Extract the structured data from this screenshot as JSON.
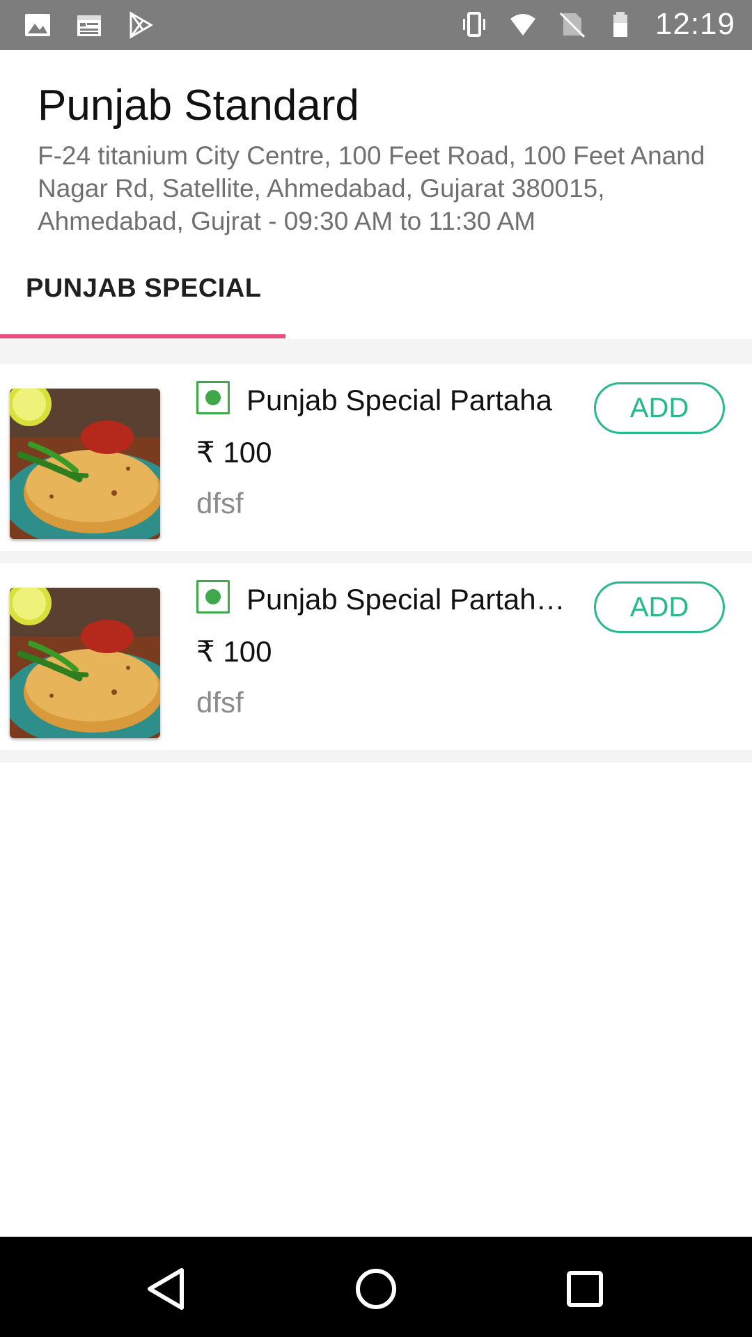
{
  "status_bar": {
    "time": "12:19",
    "left_icons": [
      "image-icon",
      "calendar-icon",
      "play-store-icon"
    ],
    "right_icons": [
      "vibrate-icon",
      "wifi-icon",
      "no-sim-icon",
      "battery-icon"
    ]
  },
  "restaurant": {
    "name": "Punjab Standard",
    "address": "F-24 titanium City Centre, 100 Feet Road, 100 Feet Anand Nagar Rd, Satellite, Ahmedabad, Gujarat 380015, Ahmedabad, Gujrat - 09:30 AM to 11:30 AM"
  },
  "tabs": [
    {
      "label": "PUNJAB SPECIAL",
      "active": true
    }
  ],
  "items": [
    {
      "name": "Punjab Special Partaha",
      "price": "₹ 100",
      "description": "dfsf",
      "add_label": "ADD",
      "veg": true
    },
    {
      "name": "Punjab Special Partaha...",
      "price": "₹ 100",
      "description": "dfsf",
      "add_label": "ADD",
      "veg": true
    }
  ],
  "colors": {
    "accent_tab": "#ea4d7f",
    "add_button": "#26b98a",
    "veg_marker": "#3ea84a",
    "status_bar": "#7d7d7d"
  },
  "nav_icons": [
    "back-icon",
    "home-icon",
    "recents-icon"
  ]
}
